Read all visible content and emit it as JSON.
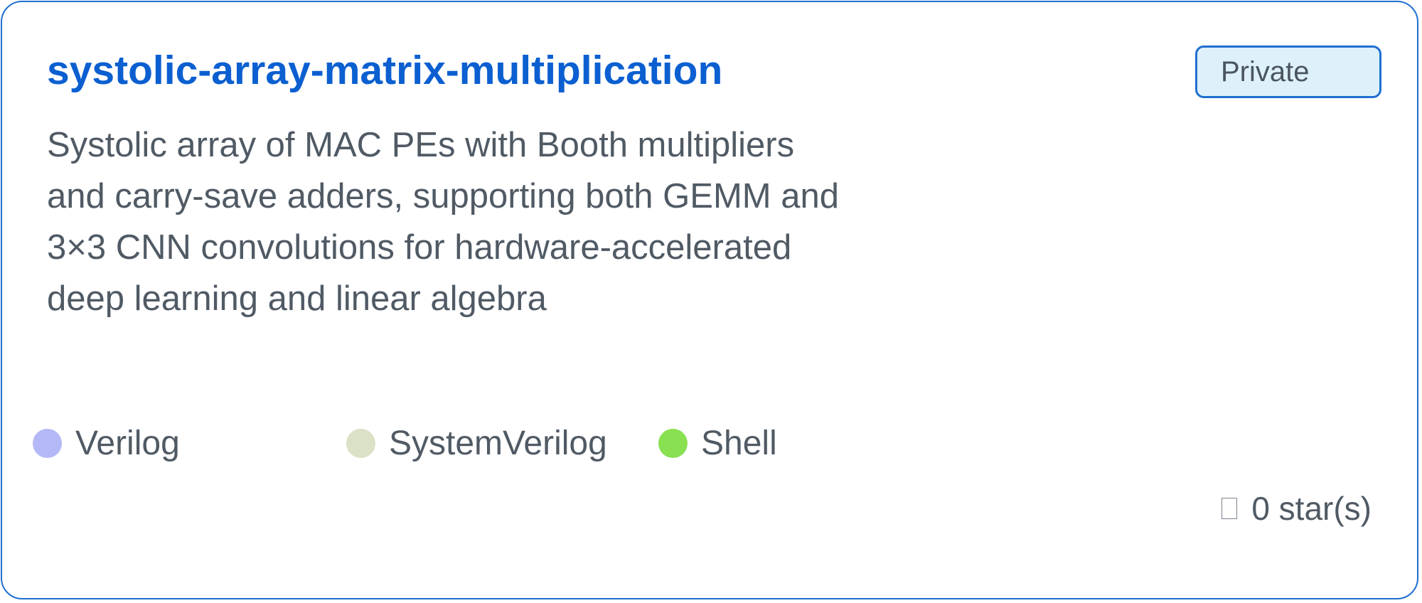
{
  "repo": {
    "name": "systolic-array-matrix-multiplication",
    "visibility": "Private",
    "description": "Systolic array of MAC PEs with Booth multipliers and carry-save adders, supporting both GEMM and 3×3 CNN convolutions for hardware-accelerated deep learning and linear algebra",
    "languages": [
      {
        "name": "Verilog",
        "color": "#b5b8f6"
      },
      {
        "name": "SystemVerilog",
        "color": "#dbe1c6"
      },
      {
        "name": "Shell",
        "color": "#89e051"
      }
    ],
    "stars": {
      "icon": "star-icon",
      "label": "0 star(s)"
    }
  },
  "colors": {
    "accent": "#0b5fd0",
    "border": "#1f6fd1",
    "badge_bg": "#def1fb",
    "text": "#505a64"
  }
}
